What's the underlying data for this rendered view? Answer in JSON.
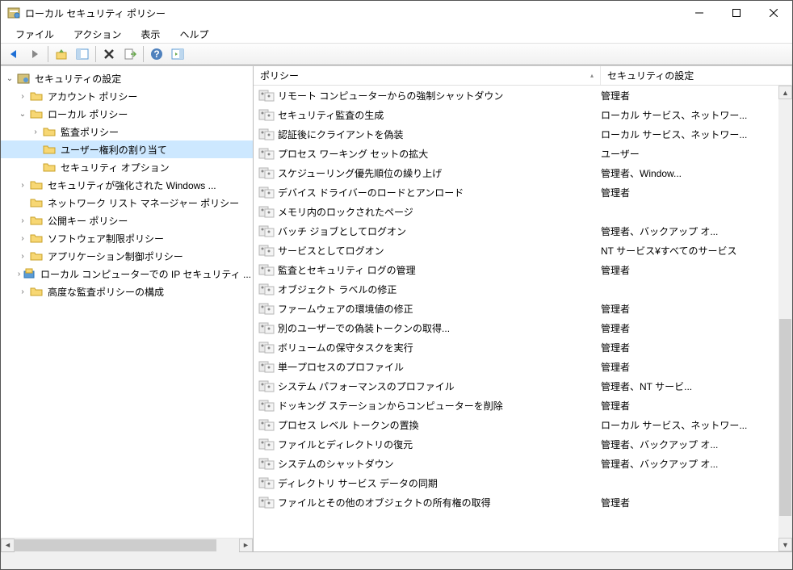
{
  "window": {
    "title": "ローカル セキュリティ ポリシー"
  },
  "menu": {
    "file": "ファイル",
    "action": "アクション",
    "view": "表示",
    "help": "ヘルプ"
  },
  "tree": {
    "root": "セキュリティの設定",
    "account_policy": "アカウント ポリシー",
    "local_policy": "ローカル ポリシー",
    "audit_policy": "監査ポリシー",
    "user_rights": "ユーザー権利の割り当て",
    "security_options": "セキュリティ オプション",
    "windows_firewall": "セキュリティが強化された Windows ...",
    "network_list": "ネットワーク リスト マネージャー ポリシー",
    "public_key": "公開キー ポリシー",
    "software_restriction": "ソフトウェア制限ポリシー",
    "app_control": "アプリケーション制御ポリシー",
    "ip_security": "ローカル コンピューターでの IP セキュリティ ...",
    "advanced_audit": "高度な監査ポリシーの構成"
  },
  "columns": {
    "policy": "ポリシー",
    "security_setting": "セキュリティの設定"
  },
  "policies": [
    {
      "name": "リモート コンピューターからの強制シャットダウン",
      "setting": "管理者"
    },
    {
      "name": "セキュリティ監査の生成",
      "setting": "ローカル サービス、ネットワー..."
    },
    {
      "name": "認証後にクライアントを偽装",
      "setting": "ローカル サービス、ネットワー..."
    },
    {
      "name": "プロセス ワーキング セットの拡大",
      "setting": "ユーザー"
    },
    {
      "name": "スケジューリング優先順位の繰り上げ",
      "setting": "管理者、Window..."
    },
    {
      "name": "デバイス ドライバーのロードとアンロード",
      "setting": "管理者"
    },
    {
      "name": "メモリ内のロックされたページ",
      "setting": ""
    },
    {
      "name": "バッチ ジョブとしてログオン",
      "setting": "管理者、バックアップ オ..."
    },
    {
      "name": "サービスとしてログオン",
      "setting": "NT サービス¥すべてのサービス"
    },
    {
      "name": "監査とセキュリティ ログの管理",
      "setting": "管理者"
    },
    {
      "name": "オブジェクト ラベルの修正",
      "setting": ""
    },
    {
      "name": "ファームウェアの環境値の修正",
      "setting": "管理者"
    },
    {
      "name": "別のユーザーでの偽装トークンの取得...",
      "setting": "管理者"
    },
    {
      "name": "ボリュームの保守タスクを実行",
      "setting": "管理者"
    },
    {
      "name": "単一プロセスのプロファイル",
      "setting": "管理者"
    },
    {
      "name": "システム パフォーマンスのプロファイル",
      "setting": "管理者、NT サービ..."
    },
    {
      "name": "ドッキング ステーションからコンピューターを削除",
      "setting": "管理者"
    },
    {
      "name": "プロセス レベル トークンの置換",
      "setting": "ローカル サービス、ネットワー..."
    },
    {
      "name": "ファイルとディレクトリの復元",
      "setting": "管理者、バックアップ オ..."
    },
    {
      "name": "システムのシャットダウン",
      "setting": "管理者、バックアップ オ..."
    },
    {
      "name": "ディレクトリ サービス データの同期",
      "setting": ""
    },
    {
      "name": "ファイルとその他のオブジェクトの所有権の取得",
      "setting": "管理者"
    }
  ]
}
